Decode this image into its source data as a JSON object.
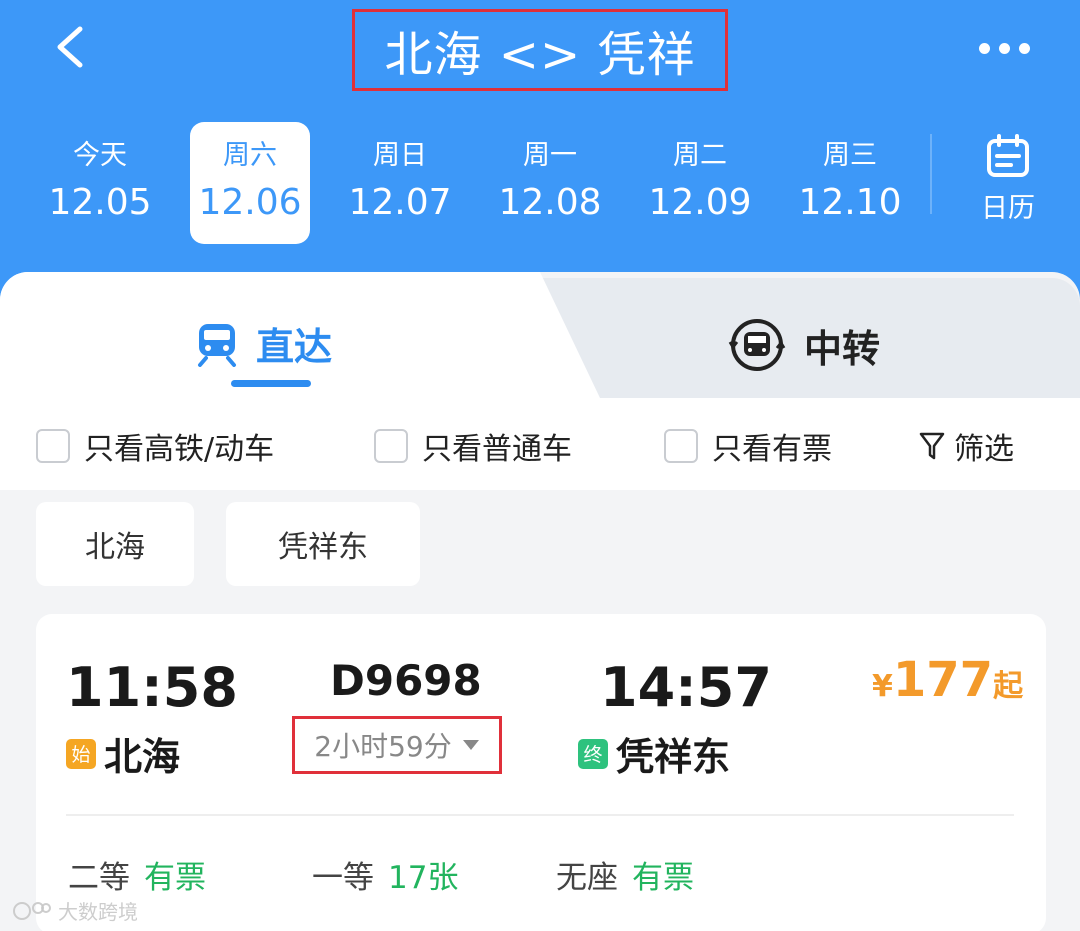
{
  "header": {
    "title": "北海 <> 凭祥",
    "dates": [
      {
        "weekday": "今天",
        "date": "12.05",
        "active": false
      },
      {
        "weekday": "周六",
        "date": "12.06",
        "active": true
      },
      {
        "weekday": "周日",
        "date": "12.07",
        "active": false
      },
      {
        "weekday": "周一",
        "date": "12.08",
        "active": false
      },
      {
        "weekday": "周二",
        "date": "12.09",
        "active": false
      },
      {
        "weekday": "周三",
        "date": "12.10",
        "active": false
      }
    ],
    "calendar_label": "日历"
  },
  "tabs": {
    "direct": "直达",
    "transfer": "中转"
  },
  "filters": {
    "high_speed": "只看高铁/动车",
    "regular": "只看普通车",
    "available": "只看有票",
    "filter": "筛选"
  },
  "stations": [
    "北海",
    "凭祥东"
  ],
  "train": {
    "dep_time": "11:58",
    "arr_time": "14:57",
    "train_no": "D9698",
    "duration": "2小时59分",
    "dep_badge": "始",
    "dep_station": "北海",
    "arr_badge": "终",
    "arr_station": "凭祥东",
    "price_currency": "¥",
    "price": "177",
    "price_suffix": "起",
    "seats": [
      {
        "class": "二等",
        "status": "有票"
      },
      {
        "class": "一等",
        "status": "17张"
      },
      {
        "class": "无座",
        "status": "有票"
      }
    ]
  },
  "watermark": "大数跨境",
  "colors": {
    "header_bg": "#3d98f8",
    "accent": "#2d8cf0",
    "price": "#f39a2b",
    "available": "#22b45e",
    "highlight_box": "#e0303a"
  }
}
